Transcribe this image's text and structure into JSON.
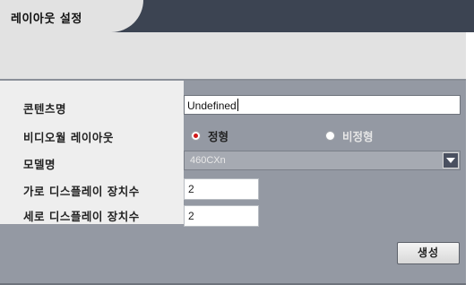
{
  "window": {
    "title": "레이아웃 설정"
  },
  "form": {
    "content_name": {
      "label": "콘텐츠명",
      "value": "Undefined"
    },
    "video_wall_layout": {
      "label": "비디오월 레이아웃",
      "options": [
        {
          "label": "정형",
          "selected": true
        },
        {
          "label": "비정형",
          "selected": false
        }
      ]
    },
    "model_name": {
      "label": "모델명",
      "value": "460CXn"
    },
    "horizontal_count": {
      "label": "가로 디스플레이 장치수",
      "value": "2"
    },
    "vertical_count": {
      "label": "세로 디스플레이 장치수",
      "value": "2"
    },
    "create_button": "생성"
  },
  "colors": {
    "tab_dark": "#3c4452",
    "panel": "#9499a3",
    "label_bg": "#eeeeee",
    "radio_selected": "#d01818"
  }
}
